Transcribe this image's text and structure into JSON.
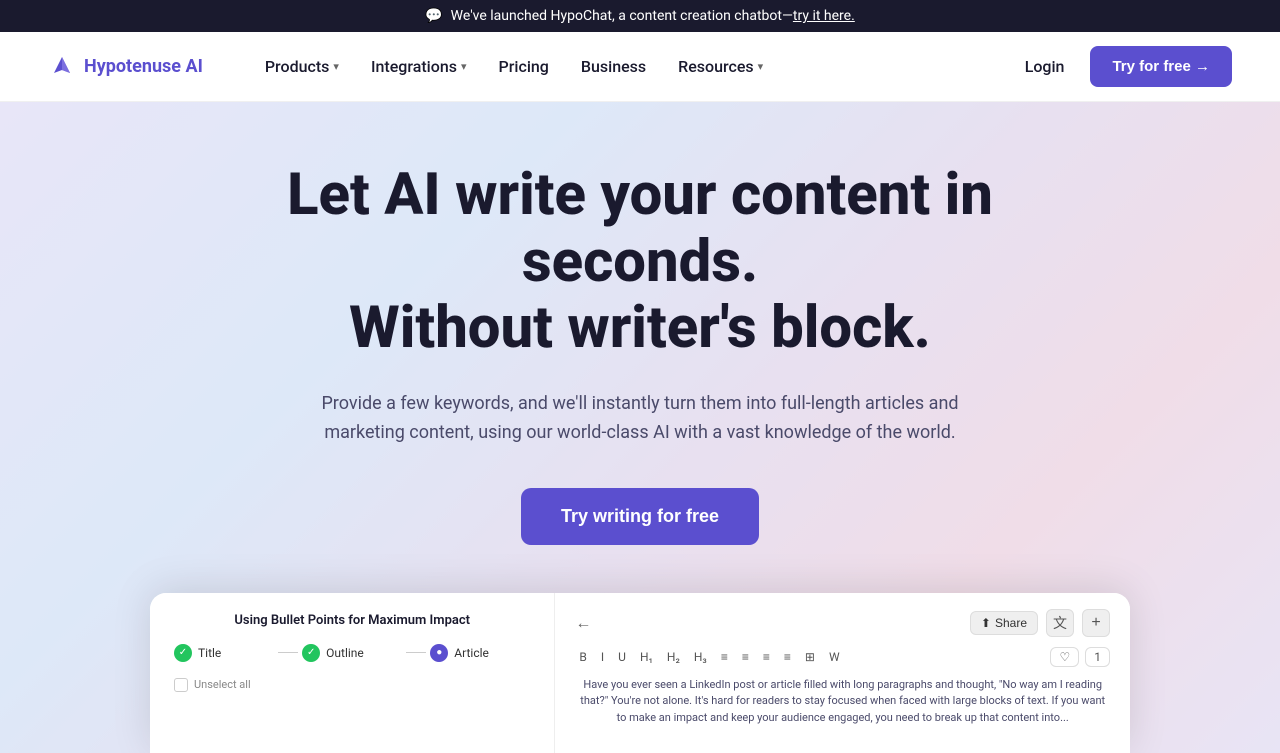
{
  "announcement": {
    "icon": "💬",
    "text": "We've launched HypoChat, a content creation chatbot—try it here.",
    "link_text": "try it here."
  },
  "nav": {
    "logo_text": "Hypotenuse AI",
    "links": [
      {
        "label": "Products",
        "has_dropdown": true
      },
      {
        "label": "Integrations",
        "has_dropdown": true
      },
      {
        "label": "Pricing",
        "has_dropdown": false
      },
      {
        "label": "Business",
        "has_dropdown": false
      },
      {
        "label": "Resources",
        "has_dropdown": true
      }
    ],
    "login_label": "Login",
    "try_label": "Try for free →"
  },
  "hero": {
    "title_line1": "Let AI write your content in seconds.",
    "title_line2": "Without writer's block.",
    "subtitle": "Provide a few keywords, and we'll instantly turn them into full-length articles and marketing content, using our world-class AI with a vast knowledge of the world.",
    "cta_label": "Try writing for free"
  },
  "preview": {
    "left": {
      "title": "Using Bullet Points for Maximum Impact",
      "steps": [
        {
          "label": "Title",
          "status": "done"
        },
        {
          "label": "Outline",
          "status": "done"
        },
        {
          "label": "Article",
          "status": "active"
        }
      ],
      "unselect_label": "Unselect all"
    },
    "right": {
      "back_icon": "←",
      "share_label": "Share",
      "translate_icon": "文",
      "plus_icon": "+",
      "editor_tools": [
        "B",
        "I",
        "U",
        "H₁",
        "H₂",
        "H₃",
        "≡",
        "≡",
        "≡",
        "≡",
        "⊞",
        "W"
      ],
      "heart_icon": "♡",
      "count": "1",
      "body_text": "Have you ever seen a LinkedIn post or article filled with long paragraphs and thought, \"No way am I reading that?\" You're not alone. It's hard for readers to stay focused when faced with large blocks of text. If you want to make an impact and keep your audience engaged, you need to break up that content into..."
    }
  },
  "colors": {
    "brand_purple": "#5b4fcf",
    "nav_bg": "#ffffff",
    "hero_bg_start": "#e8e6f8",
    "text_dark": "#1a1a2e",
    "announcement_bg": "#1a1a2e"
  }
}
